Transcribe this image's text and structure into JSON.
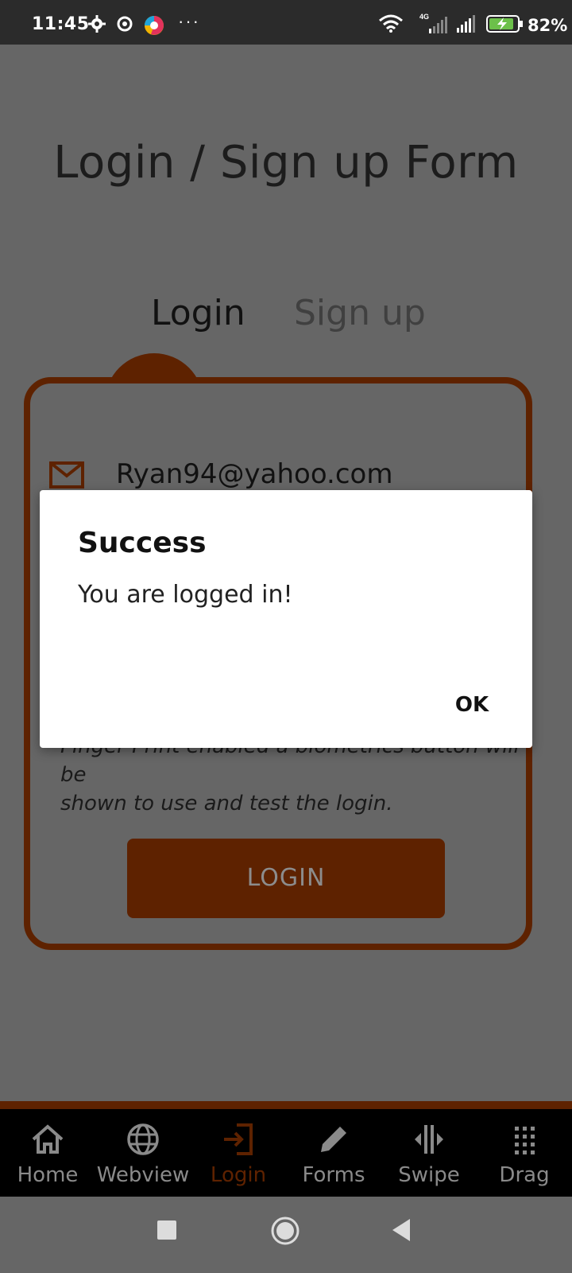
{
  "status_bar": {
    "time": "11:45",
    "network": "4G",
    "battery_percent": "82%"
  },
  "page": {
    "title": "Login / Sign up Form",
    "tabs": [
      {
        "label": "Login",
        "active": true
      },
      {
        "label": "Sign up",
        "active": false
      }
    ],
    "form": {
      "email_value": "Ryan94@yahoo.com",
      "hint_line1": "Finger Print enabled a biometrics button will be",
      "hint_line2": "shown to use and test the login.",
      "login_button_label": "LOGIN"
    }
  },
  "dialog": {
    "title": "Success",
    "message": "You are logged in!",
    "ok_label": "OK"
  },
  "bottom_nav": {
    "items": [
      {
        "label": "Home",
        "icon": "home-icon"
      },
      {
        "label": "Webview",
        "icon": "globe-icon"
      },
      {
        "label": "Login",
        "icon": "login-icon",
        "active": true
      },
      {
        "label": "Forms",
        "icon": "pencil-icon"
      },
      {
        "label": "Swipe",
        "icon": "swipe-icon"
      },
      {
        "label": "Drag",
        "icon": "grid-icon"
      }
    ]
  },
  "colors": {
    "accent": "#5e2200",
    "overlay_background": "#666666",
    "dialog_background": "#ffffff"
  }
}
